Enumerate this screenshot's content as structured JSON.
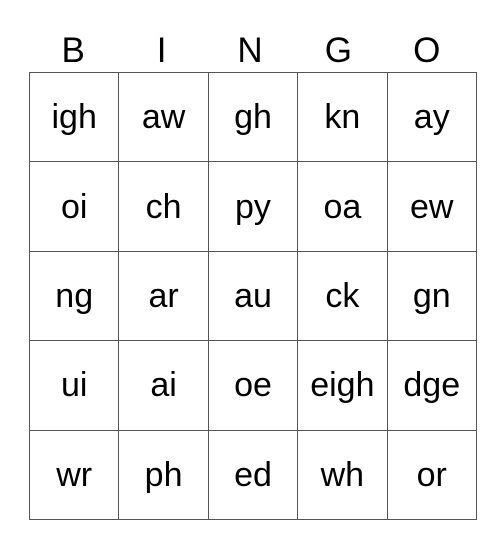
{
  "header": [
    "B",
    "I",
    "N",
    "G",
    "O"
  ],
  "rows": [
    [
      "igh",
      "aw",
      "gh",
      "kn",
      "ay"
    ],
    [
      "oi",
      "ch",
      "py",
      "oa",
      "ew"
    ],
    [
      "ng",
      "ar",
      "au",
      "ck",
      "gn"
    ],
    [
      "ui",
      "ai",
      "oe",
      "eigh",
      "dge"
    ],
    [
      "wr",
      "ph",
      "ed",
      "wh",
      "or"
    ]
  ]
}
